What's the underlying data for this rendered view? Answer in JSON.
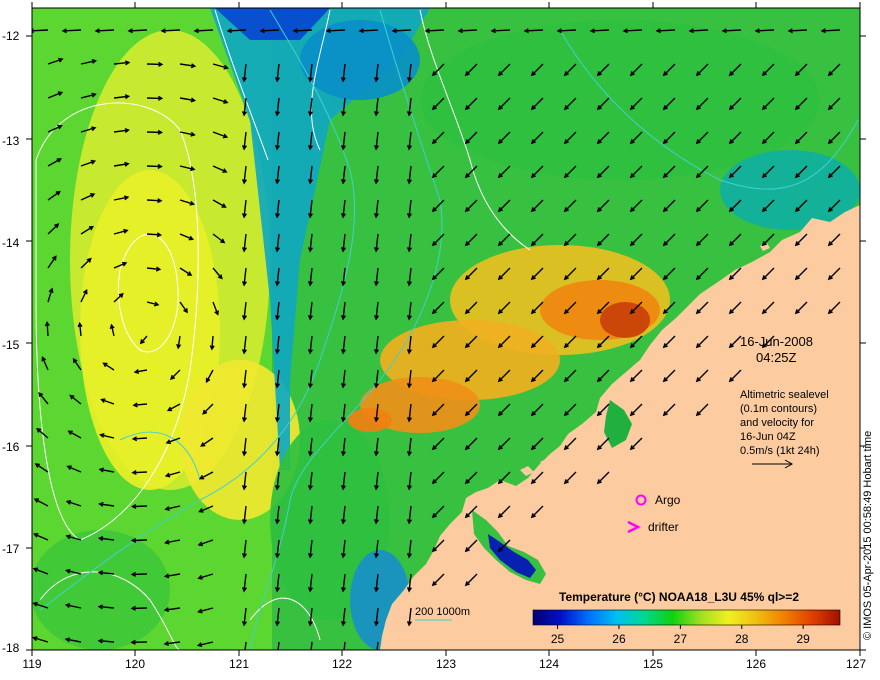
{
  "map": {
    "date_line": "16-Jun-2008",
    "time_line": "04:25Z",
    "info_lines": [
      "Altimetric sealevel",
      "(0.1m contours)",
      "and velocity for",
      "16-Jun 04Z",
      "0.5m/s (1kt 24h)"
    ],
    "legend": {
      "argo_label": "Argo",
      "drifter_label": "drifter"
    },
    "bathymetry_label": "200  1000m",
    "colorbar": {
      "title": "Temperature (°C) NOAA18_L3U 45% ql>=2",
      "ticks": [
        "25",
        "26",
        "27",
        "28",
        "29"
      ],
      "range": [
        24.6,
        29.6
      ],
      "colors": [
        "#000070",
        "#0010c8",
        "#0070ff",
        "#00c0f0",
        "#00d890",
        "#10d010",
        "#a0e020",
        "#f0f020",
        "#f0c010",
        "#f08000",
        "#e04000",
        "#a01000"
      ]
    },
    "x_ticks": [
      "119",
      "120",
      "121",
      "122",
      "123",
      "124",
      "125",
      "126",
      "127"
    ],
    "y_ticks": [
      "-12",
      "-13",
      "-14",
      "-15",
      "-16",
      "-17",
      "-18"
    ],
    "credit": "© IMOS 05-Apr-2015 00:58:49 Hobart time",
    "colors": {
      "land": "#fccca0",
      "arrows": "#000000",
      "contours": "#ffffff",
      "bathymetry": "#40d0d0",
      "argo_marker": "#ff00ff",
      "drifter_marker": "#ff00ff"
    }
  }
}
